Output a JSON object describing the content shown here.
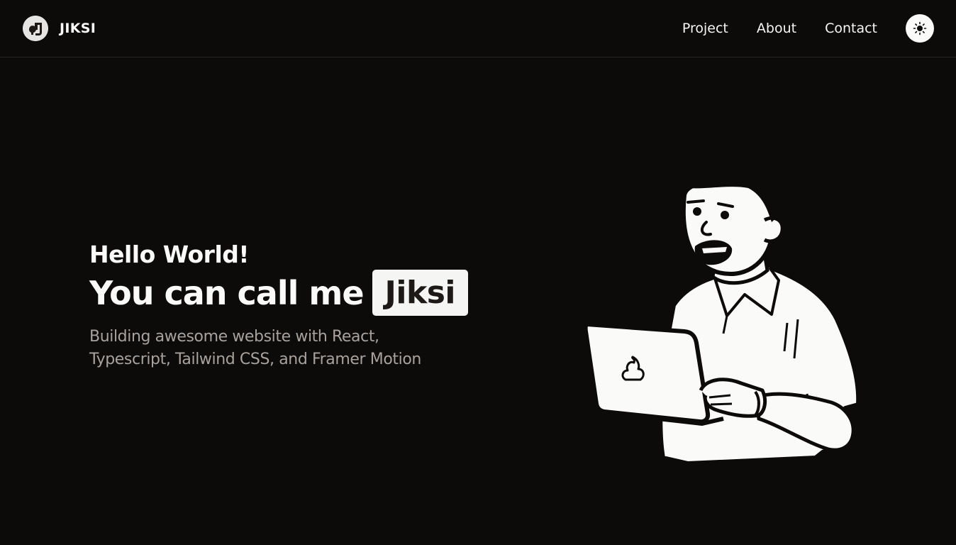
{
  "header": {
    "brand_name": "JIKSI",
    "logo_icon": "logo-icon",
    "nav": [
      {
        "label": "Project"
      },
      {
        "label": "About"
      },
      {
        "label": "Contact"
      }
    ],
    "theme_toggle_icon": "sun-icon"
  },
  "hero": {
    "greeting": "Hello World!",
    "headline_prefix": "You can call me",
    "name": "Jiksi",
    "subtitle": "Building awesome website with React, Typescript, Tailwind CSS, and Framer Motion"
  },
  "colors": {
    "background": "#0c0b0a",
    "text": "#fafaf9",
    "muted_text": "#a8a29e",
    "badge_bg": "#f5f5f4",
    "badge_text": "#1c1917"
  }
}
